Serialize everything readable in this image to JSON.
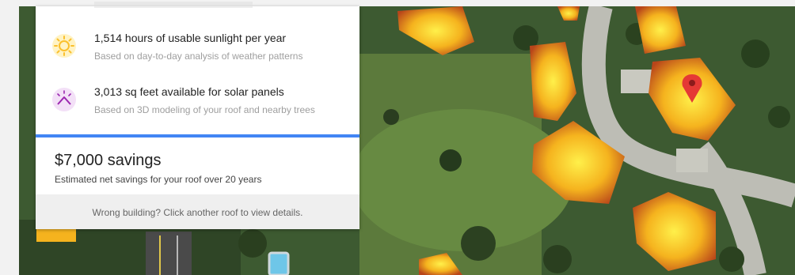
{
  "card": {
    "sunlight": {
      "title": "1,514 hours of usable sunlight per year",
      "subtitle": "Based on day-to-day analysis of weather patterns",
      "icon": "sun-icon"
    },
    "roof": {
      "title": "3,013 sq feet available for solar panels",
      "subtitle": "Based on 3D modeling of your roof and nearby trees",
      "icon": "roof-icon"
    },
    "savings": {
      "amount": "$7,000 savings",
      "subtitle": "Estimated net savings for your roof over 20 years"
    },
    "footer": "Wrong building? Click another roof to view details."
  },
  "colors": {
    "accent": "#4285f4",
    "sun_icon": "#fbc02d",
    "roof_icon": "#9c27b0",
    "marker": "#e53935"
  },
  "map": {
    "marker_icon": "map-pin-icon"
  }
}
